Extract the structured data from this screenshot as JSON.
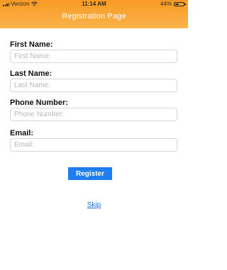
{
  "status_bar": {
    "carrier": "Verizon",
    "time": "11:14 AM",
    "battery_text": "44%",
    "battery_level": 0.44
  },
  "header": {
    "title": "Registration Page"
  },
  "form": {
    "first_name": {
      "label": "First Name:",
      "placeholder": "First Name:",
      "value": ""
    },
    "last_name": {
      "label": "Last Name:",
      "placeholder": "Last Name:",
      "value": ""
    },
    "phone": {
      "label": "Phone Number:",
      "placeholder": "Phone Number:",
      "value": ""
    },
    "email": {
      "label": "Email:",
      "placeholder": "Email:",
      "value": ""
    }
  },
  "actions": {
    "register_label": "Register",
    "skip_label": "Skip"
  },
  "colors": {
    "header_orange": "#f89b25",
    "button_blue": "#1e7ef0",
    "link_blue": "#1e6ee6"
  }
}
